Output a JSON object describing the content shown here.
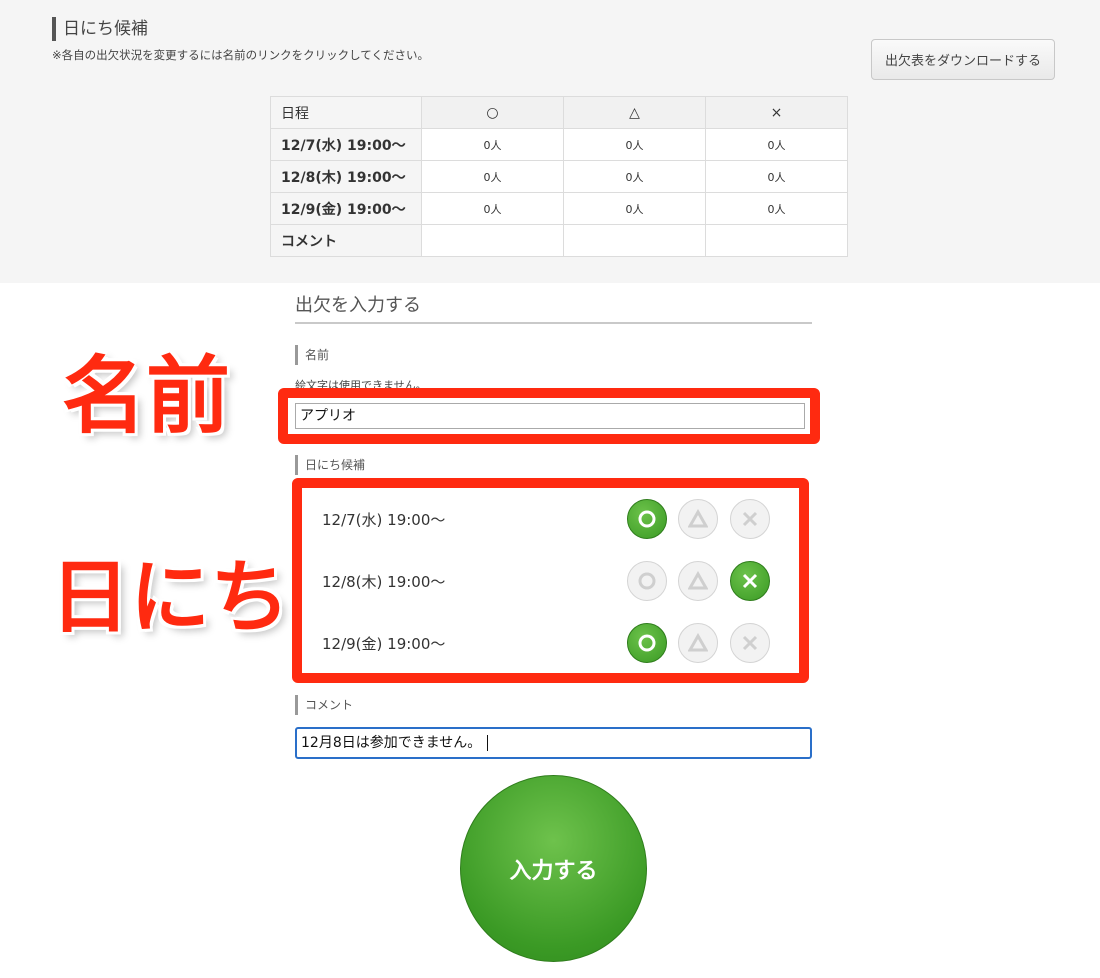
{
  "summary": {
    "title": "日にち候補",
    "note": "※各自の出欠状況を変更するには名前のリンクをクリックしてください。",
    "download_label": "出欠表をダウンロードする",
    "table": {
      "header": [
        "日程",
        "○",
        "△",
        "×"
      ],
      "rows": [
        {
          "date": "12/7(水) 19:00〜",
          "ok": "0人",
          "maybe": "0人",
          "ng": "0人"
        },
        {
          "date": "12/8(木) 19:00〜",
          "ok": "0人",
          "maybe": "0人",
          "ng": "0人"
        },
        {
          "date": "12/9(金) 19:00〜",
          "ok": "0人",
          "maybe": "0人",
          "ng": "0人"
        }
      ],
      "comment_label": "コメント"
    }
  },
  "form": {
    "title": "出欠を入力する",
    "name_label": "名前",
    "name_hint": "絵文字は使用できません。",
    "name_value": "アプリオ",
    "dates_label": "日にち候補",
    "dates": [
      {
        "label": "12/7(水) 19:00〜",
        "selected": "ok"
      },
      {
        "label": "12/8(木) 19:00〜",
        "selected": "ng"
      },
      {
        "label": "12/9(金) 19:00〜",
        "selected": "ok"
      }
    ],
    "comment_label": "コメント",
    "comment_value": "12月8日は参加できません。",
    "submit_label": "入力する"
  },
  "annotations": {
    "name": "名前",
    "dates": "日にち"
  },
  "colors": {
    "highlight": "#ff2a10",
    "selected_green": "#3a9a24",
    "focus_blue": "#2a6fc9"
  }
}
